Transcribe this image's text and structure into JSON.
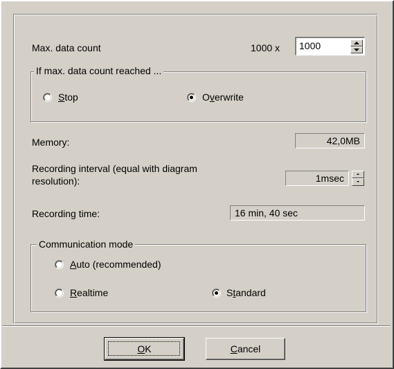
{
  "max_count": {
    "label_pre": "Max. data count",
    "multiplier": "1000 x",
    "value": "1000"
  },
  "reached_group": {
    "legend": "If max. data count reached ...",
    "stop": {
      "mnemonic": "S",
      "rest": "top",
      "selected": false
    },
    "overwrite": {
      "pre": "O",
      "mnemonic": "v",
      "rest": "erwrite",
      "selected": true
    }
  },
  "memory": {
    "label": "Memory:",
    "value": "42,0MB"
  },
  "interval": {
    "label_line1": "Recording interval (equal with diagram",
    "label_line2": "resolution):",
    "value": "1msec"
  },
  "rec_time": {
    "label": "Recording time:",
    "value": "16 min, 40 sec"
  },
  "comm_group": {
    "legend": "Communication mode",
    "auto": {
      "mnemonic": "A",
      "rest": "uto (recommended)",
      "selected": false
    },
    "realtime": {
      "mnemonic": "R",
      "rest": "ealtime",
      "selected": false
    },
    "standard": {
      "pre": "S",
      "mnemonic": "t",
      "rest": "andard",
      "selected": true
    }
  },
  "buttons": {
    "ok": {
      "mnemonic": "O",
      "rest": "K"
    },
    "cancel": {
      "mnemonic": "C",
      "rest": "ancel"
    }
  },
  "icons": {
    "spin_up": "triangle-up",
    "spin_down": "triangle-down",
    "radio": "radio-circle"
  },
  "colors": {
    "face": "#d4d0c8",
    "shadow": "#808080",
    "highlight": "#ffffff",
    "field": "#ffffff"
  }
}
